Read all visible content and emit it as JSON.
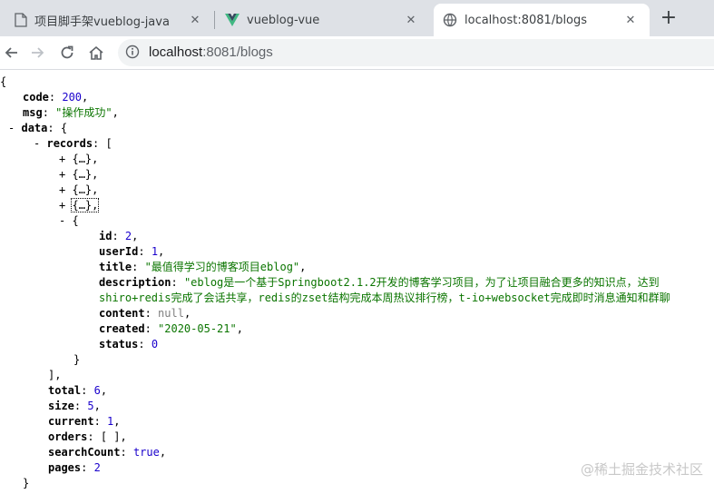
{
  "tabs": [
    {
      "title": "项目脚手架vueblog-java",
      "icon": "document-icon"
    },
    {
      "title": "vueblog-vue",
      "icon": "vue-logo-icon"
    },
    {
      "title": "localhost:8081/blogs",
      "icon": "globe-icon",
      "active": true
    }
  ],
  "toolbar": {
    "url_host": "localhost",
    "url_path": ":8081/blogs"
  },
  "json": {
    "open_brace": "{",
    "close_brace": "}",
    "code_key": "code",
    "code_val": "200",
    "msg_key": "msg",
    "msg_val": "\"操作成功\"",
    "data_key": "data",
    "records_key": "records",
    "collapsed_item": "{…},",
    "record": {
      "id_key": "id",
      "id_val": "2",
      "userId_key": "userId",
      "userId_val": "1",
      "title_key": "title",
      "title_val": "\"最值得学习的博客项目eblog\"",
      "description_key": "description",
      "description_val1": "\"eblog是一个基于Springboot2.1.2开发的博客学习项目，为了让项目融合更多的知识点，达到",
      "description_val2": "shiro+redis完成了会话共享，redis的zset结构完成本周热议排行榜，t-io+websocket完成即时消息通知和群聊",
      "content_key": "content",
      "content_val": "null",
      "created_key": "created",
      "created_val": "\"2020-05-21\"",
      "status_key": "status",
      "status_val": "0"
    },
    "total_key": "total",
    "total_val": "6",
    "size_key": "size",
    "size_val": "5",
    "current_key": "current",
    "current_val": "1",
    "orders_key": "orders",
    "orders_val": "[ ]",
    "searchCount_key": "searchCount",
    "searchCount_val": "true",
    "pages_key": "pages",
    "pages_val": "2"
  },
  "watermark": "@稀土掘金技术社区",
  "colors": {
    "string": "#0b7500",
    "number": "#1a01cc",
    "null": "#808080"
  }
}
